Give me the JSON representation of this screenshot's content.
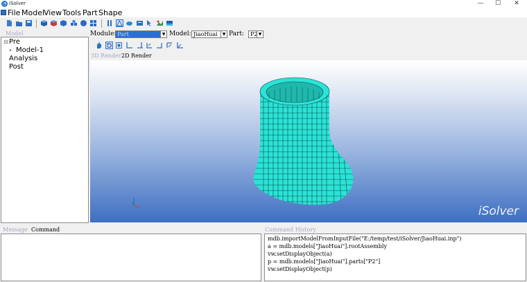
{
  "window": {
    "title": "iSolver",
    "min": "—",
    "max": "☐",
    "close": "✕"
  },
  "menus": [
    "File",
    "Model",
    "View",
    "Tools",
    "Part",
    "Shape"
  ],
  "left_panel": {
    "label": "Model",
    "tree": [
      "Pre",
      "Model-1",
      "Analysis",
      "Post"
    ]
  },
  "options": {
    "module_label": "Module:",
    "module_value": "Part",
    "model_label": "Model:",
    "model_value": "JiaoHuai",
    "part_label": "Part:",
    "part_value": "P2"
  },
  "render_tabs": [
    "3D Render",
    "2D Render"
  ],
  "viewport": {
    "watermark": "iSolver"
  },
  "bottom": {
    "message_tab": "Message",
    "command_tab": "Command",
    "history_label": "Command History",
    "history": [
      "mdb.importModelFromInputFile(\"E:/temp/test/iSolver/JiaoHuai.inp\")",
      "a = mdb.models[\"JiaoHuai\"].rootAssembly",
      "vw.setDisplayObject(a)",
      "p = mdb.models[\"JiaoHuai\"].parts[\"P2\"]",
      "vw.setDisplayObject(p)"
    ]
  },
  "colors": {
    "mesh_fill": "#2be3d6",
    "mesh_line": "#0a4a48",
    "accent": "#2b6fd6"
  }
}
